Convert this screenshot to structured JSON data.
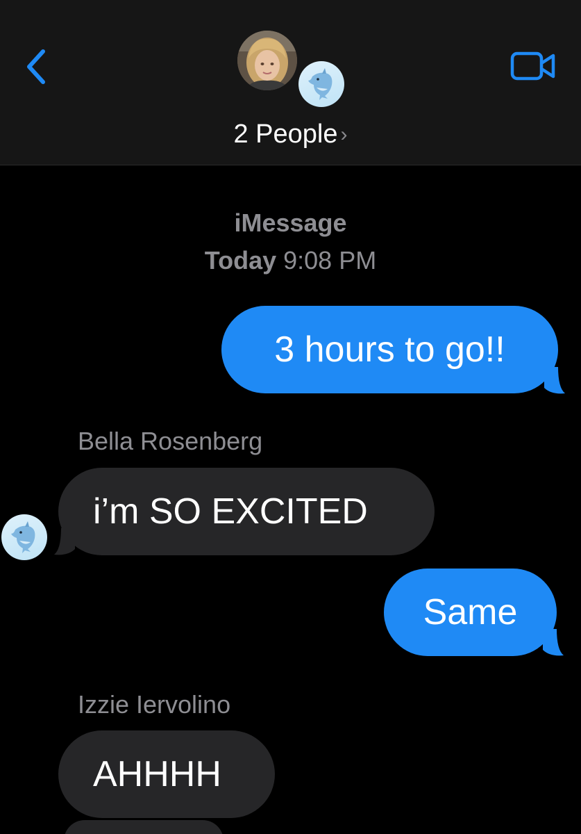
{
  "header": {
    "title": "2 People",
    "title_chevron": "›",
    "back_icon": "chevron-left-icon",
    "video_icon": "video-camera-icon",
    "accent_color": "#1f8af5"
  },
  "conversation": {
    "service": "iMessage",
    "timestamp_day": "Today",
    "timestamp_time": "9:08 PM"
  },
  "messages": [
    {
      "direction": "sent",
      "text": "3 hours to go!!"
    },
    {
      "direction": "received",
      "sender": "Bella Rosenberg",
      "text": "i’m SO EXCITED"
    },
    {
      "direction": "sent",
      "text": "Same"
    },
    {
      "direction": "received",
      "sender": "Izzie Iervolino",
      "text": "AHHHH"
    }
  ],
  "colors": {
    "sent_bubble": "#1f8af5",
    "received_bubble": "#262628",
    "secondary_text": "#8e8e93",
    "header_bg": "#161616"
  }
}
